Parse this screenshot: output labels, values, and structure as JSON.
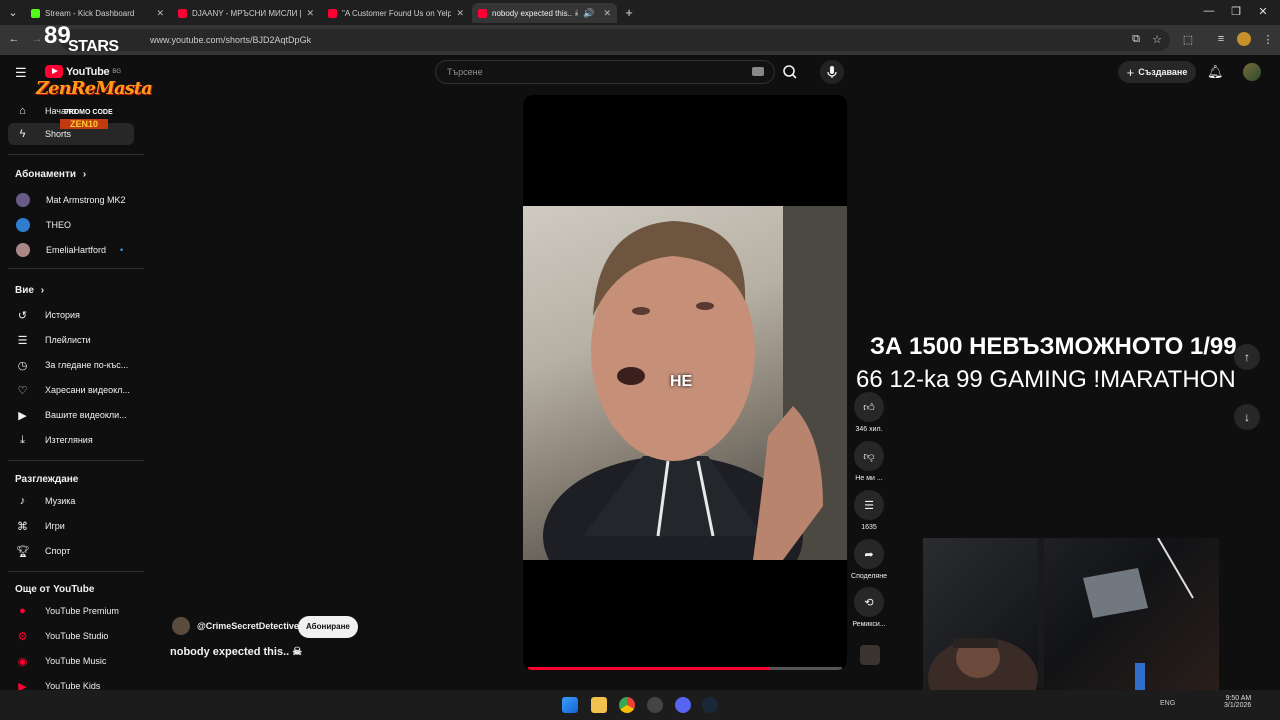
{
  "browser": {
    "tabs": [
      {
        "label": "Stream - Kick Dashboard",
        "favicon_color": "#53fc18"
      },
      {
        "label": "DJAANY - МРЪСНИ МИСЛИ [",
        "favicon_color": "#ff0033"
      },
      {
        "label": "\"A Customer Found Us on Yelp",
        "favicon_color": "#ff0033"
      },
      {
        "label": "nobody expected this.. ☠",
        "favicon_color": "#ff0033"
      }
    ],
    "url": "www.youtube.com/shorts/BJD2AqtDpGk"
  },
  "stream_logo": {
    "line1": "89",
    "line2": "STARS",
    "line3": "ZenReMasta",
    "promo": "PROMO CODE",
    "code": "ZEN10"
  },
  "youtube": {
    "logo_text": "YouTube",
    "logo_sup": "BG",
    "search_placeholder": "Търсене",
    "create_label": "Създаване",
    "sidebar": {
      "main": [
        {
          "label": "Начало",
          "icon": "home-icon"
        },
        {
          "label": "Shorts",
          "icon": "shorts-icon"
        }
      ],
      "subscriptions_heading": "Абонаменти",
      "subscriptions": [
        {
          "label": "Mat Armstrong MK2",
          "color": "#6a5a8a"
        },
        {
          "label": "THEO",
          "color": "#2e7dd1"
        },
        {
          "label": "EmeliaHartford",
          "color": "#a88",
          "dot": "•"
        }
      ],
      "you_heading": "Вие",
      "you": [
        {
          "label": "История",
          "icon": "history-icon"
        },
        {
          "label": "Плейлисти",
          "icon": "playlists-icon"
        },
        {
          "label": "За гледане по-къс...",
          "icon": "watch-later-icon"
        },
        {
          "label": "Харесани видеокл...",
          "icon": "liked-icon"
        },
        {
          "label": "Вашите видеокли...",
          "icon": "your-videos-icon"
        },
        {
          "label": "Изтегляния",
          "icon": "downloads-icon"
        }
      ],
      "explore_heading": "Разглеждане",
      "explore": [
        {
          "label": "Музика",
          "icon": "music-icon"
        },
        {
          "label": "Игри",
          "icon": "gaming-icon"
        },
        {
          "label": "Спорт",
          "icon": "trophy-icon"
        }
      ],
      "more_heading": "Още от YouTube",
      "more": [
        {
          "label": "YouTube Premium"
        },
        {
          "label": "YouTube Studio"
        },
        {
          "label": "YouTube Music"
        },
        {
          "label": "YouTube Kids"
        }
      ]
    },
    "short": {
      "caption_word": "НЕ",
      "channel": "@CrimeSecretDetective",
      "subscribe_label": "Абониране",
      "title": "nobody expected this.. ☠",
      "progress_fraction": 0.77,
      "actions": [
        {
          "icon": "like-icon",
          "label": "346 хил."
        },
        {
          "icon": "dislike-icon",
          "label": "Не ми ..."
        },
        {
          "icon": "comments-icon",
          "label": "1635"
        },
        {
          "icon": "share-icon",
          "label": "Споделяне"
        },
        {
          "icon": "remix-icon",
          "label": "Ремикси..."
        }
      ]
    }
  },
  "stream_overlay": {
    "line1": "ЗА 1500 НЕВЪЗМОЖНОТО 1/99",
    "line2": "66 12-ka 99 GAMING !MARATHON"
  },
  "taskbar": {
    "time": "9:50 AM",
    "date": "3/1/2026",
    "lang": "ENG"
  }
}
